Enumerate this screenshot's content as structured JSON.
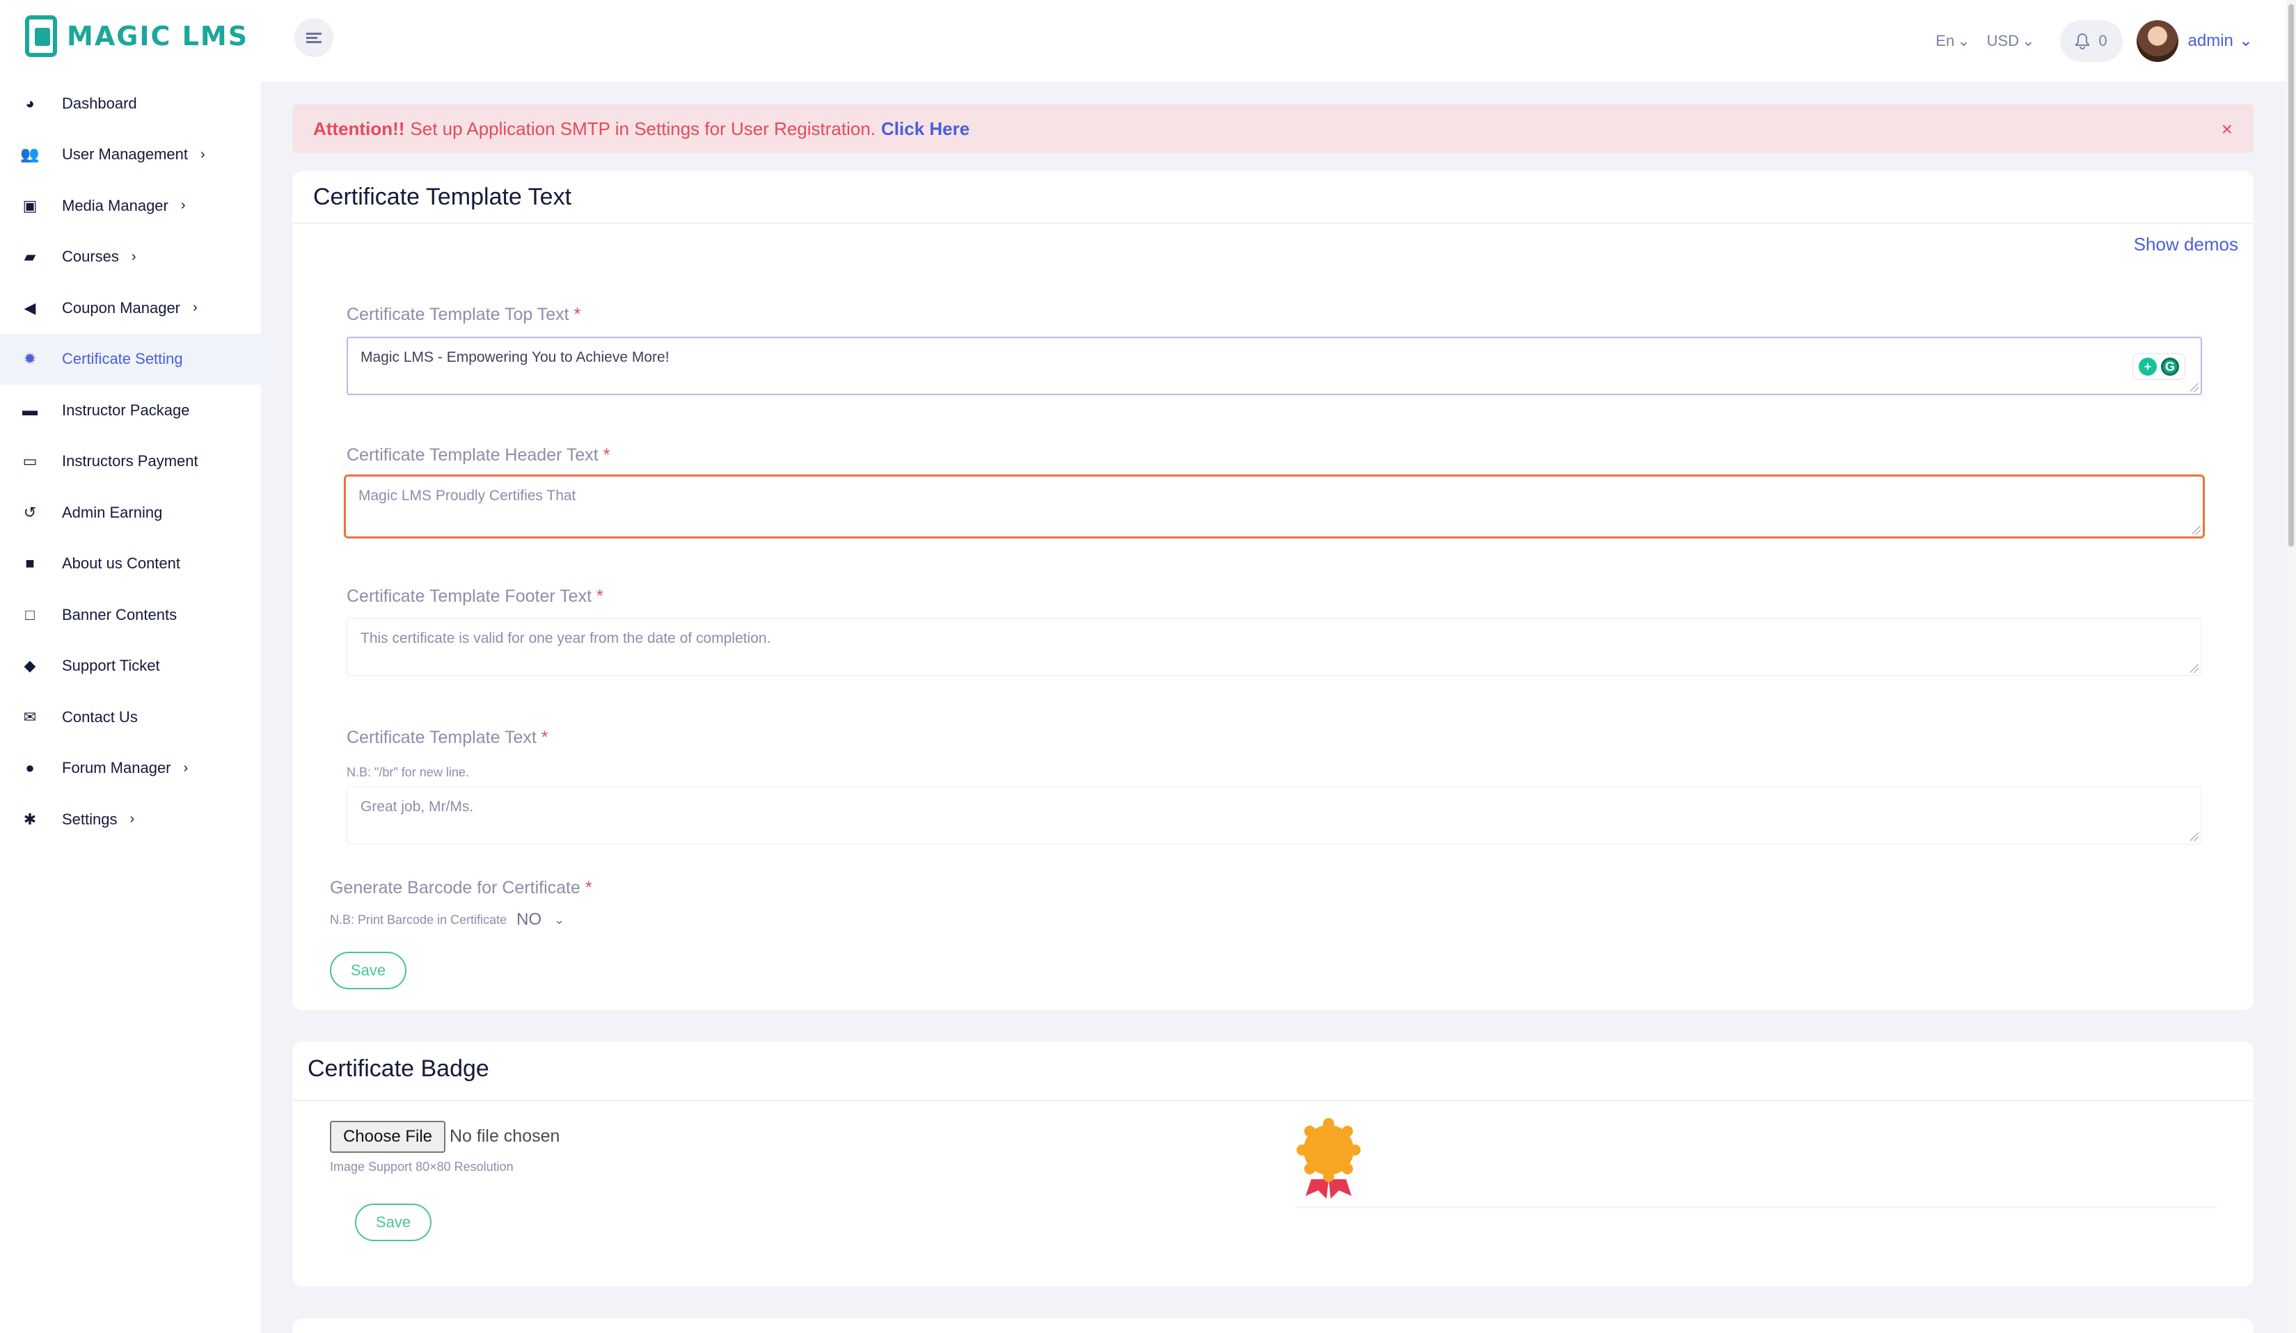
{
  "brand": {
    "name": "MAGIC LMS",
    "color": "#1ba79a",
    "accent": "#4a5fd8"
  },
  "sidebar": {
    "items": [
      {
        "label": "Dashboard",
        "icon": "palette-icon",
        "glyph": "◕",
        "has_submenu": false
      },
      {
        "label": "User Management",
        "icon": "users-icon",
        "glyph": "👥",
        "has_submenu": true
      },
      {
        "label": "Media Manager",
        "icon": "image-icon",
        "glyph": "▣",
        "has_submenu": true
      },
      {
        "label": "Courses",
        "icon": "book-icon",
        "glyph": "▰",
        "has_submenu": true
      },
      {
        "label": "Coupon Manager",
        "icon": "megaphone-icon",
        "glyph": "◀",
        "has_submenu": true
      },
      {
        "label": "Certificate Setting",
        "icon": "badge-icon",
        "glyph": "✹",
        "has_submenu": false,
        "active": true
      },
      {
        "label": "Instructor Package",
        "icon": "briefcase-icon",
        "glyph": "▬",
        "has_submenu": false
      },
      {
        "label": "Instructors Payment",
        "icon": "money-icon",
        "glyph": "▭",
        "has_submenu": false
      },
      {
        "label": "Admin Earning",
        "icon": "history-icon",
        "glyph": "↺",
        "has_submenu": false
      },
      {
        "label": "About us Content",
        "icon": "note-icon",
        "glyph": "■",
        "has_submenu": false
      },
      {
        "label": "Banner Contents",
        "icon": "sticky-note-icon",
        "glyph": "□",
        "has_submenu": false
      },
      {
        "label": "Support Ticket",
        "icon": "ticket-icon",
        "glyph": "◆",
        "has_submenu": false
      },
      {
        "label": "Contact Us",
        "icon": "envelope-open-icon",
        "glyph": "✉",
        "has_submenu": false
      },
      {
        "label": "Forum Manager",
        "icon": "question-circle-icon",
        "glyph": "●",
        "has_submenu": true
      },
      {
        "label": "Settings",
        "icon": "gear-icon",
        "glyph": "✱",
        "has_submenu": true
      }
    ]
  },
  "header": {
    "language": "En",
    "currency": "USD",
    "notification_count": "0",
    "user_name": "admin"
  },
  "alert": {
    "prefix": "Attention!!",
    "message": "Set up Application SMTP in Settings for User Registration.",
    "link": "Click Here",
    "close": "×"
  },
  "template_card": {
    "title": "Certificate Template Text",
    "show_demos": "Show demos",
    "top_text": {
      "label": "Certificate Template Top Text",
      "value": "Magic LMS - Empowering You to Achieve More!"
    },
    "header_text": {
      "label": "Certificate Template Header Text",
      "placeholder": "Magic LMS Proudly Certifies That"
    },
    "footer_text": {
      "label": "Certificate Template Footer Text",
      "placeholder": "This certificate is valid for one year from the date of completion."
    },
    "body_text": {
      "label": "Certificate Template Text",
      "note": "N.B: \"/br\" for new line.",
      "placeholder": "Great job, Mr/Ms."
    },
    "barcode": {
      "label": "Generate Barcode for Certificate",
      "note": "N.B: Print Barcode in Certificate",
      "value": "NO"
    },
    "required_mark": "*",
    "save": "Save"
  },
  "badge_card": {
    "title": "Certificate Badge",
    "choose_file": "Choose File",
    "file_status": "No file chosen",
    "note": "Image Support 80×80 Resolution",
    "save": "Save"
  }
}
